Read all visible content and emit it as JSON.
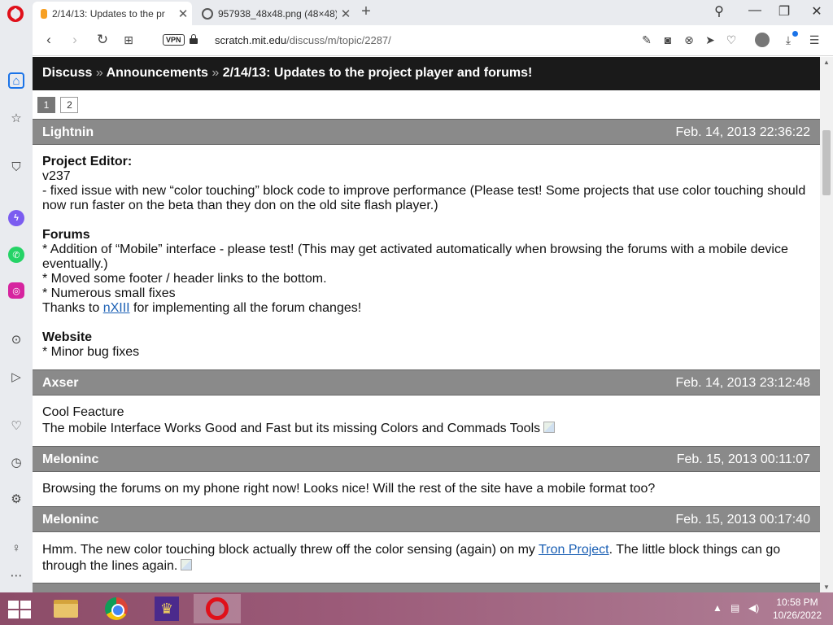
{
  "browser": {
    "tabs": [
      {
        "title": "2/14/13: Updates to the pr",
        "icon": "scratch-favicon",
        "active": true
      },
      {
        "title": "957938_48x48.png (48×48)",
        "icon": "globe-favicon",
        "active": false
      }
    ],
    "vpn_label": "VPN",
    "url_domain": "scratch.mit.edu",
    "url_path": "/discuss/m/topic/2287/"
  },
  "topic": {
    "crumb1": "Discuss",
    "crumb2": "Announcements",
    "title": "2/14/13: Updates to the project player and forums!",
    "separator": "»",
    "pages": [
      "1",
      "2"
    ],
    "current_page": "1"
  },
  "posts": [
    {
      "author": "Lightnin",
      "date": "Feb. 14, 2013 22:36:22",
      "h_editor": "Project Editor:",
      "line_v": "v237",
      "line_fix": "- fixed issue with new “color touching” block code to improve performance (Please test! Some projects that use color touching should now run faster on the beta than they don on the old site flash player.)",
      "h_forums": "Forums",
      "line_mobile": "* Addition of “Mobile” interface - please test! (This may get activated automatically when browsing the forums with a mobile device eventually.)",
      "line_footer": "* Moved some footer / header links to the bottom.",
      "line_small": "* Numerous small fixes",
      "thanks_pre": "Thanks to ",
      "thanks_link": "nXIII",
      "thanks_post": " for implementing all the forum changes!",
      "h_website": "Website",
      "line_bug": "* Minor bug fixes"
    },
    {
      "author": "Axser",
      "date": "Feb. 14, 2013 23:12:48",
      "line1": "Cool Feacture",
      "line2": "The mobile Interface Works Good and Fast but its missing Colors and Commads Tools"
    },
    {
      "author": "Meloninc",
      "date": "Feb. 15, 2013 00:11:07",
      "line1": "Browsing the forums on my phone right now! Looks nice! Will the rest of the site have a mobile format too?"
    },
    {
      "author": "Meloninc",
      "date": "Feb. 15, 2013 00:17:40",
      "pre": "Hmm. The new color touching block actually threw off the color sensing (again) on my ",
      "link": "Tron Project",
      "post": ". The little block things can go through the lines again."
    }
  ],
  "taskbar": {
    "time": "10:58 PM",
    "date": "10/26/2022"
  }
}
